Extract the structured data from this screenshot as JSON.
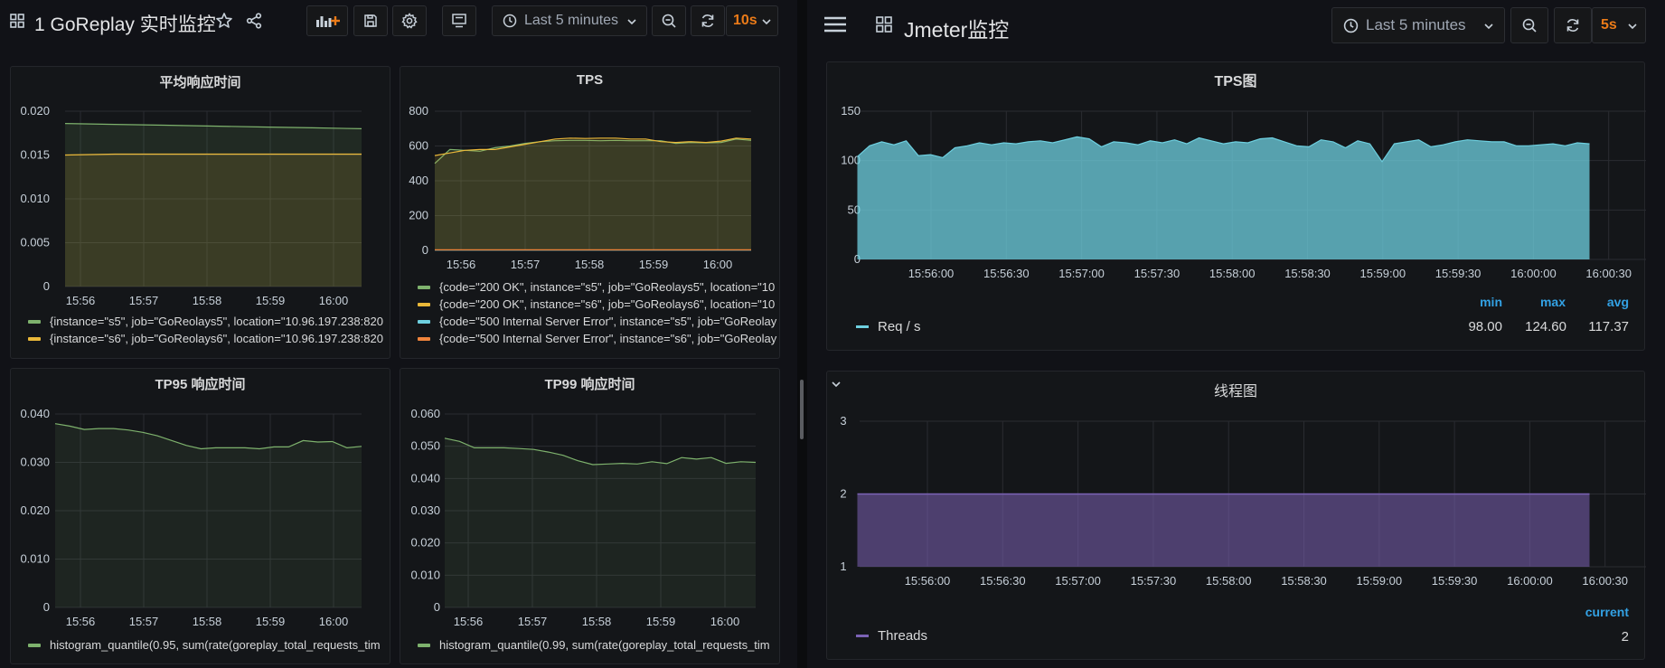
{
  "left": {
    "dashboard_title": "1 GoReplay 实时监控",
    "time_range": "Last 5 minutes",
    "refresh": "10s",
    "panels": [
      {
        "title": "平均响应时间",
        "chart_data": {
          "type": "line",
          "x": [
            "15:56",
            "15:57",
            "15:58",
            "15:59",
            "16:00"
          ],
          "ylim": [
            0,
            0.02
          ],
          "yticks": [
            "0",
            "0.005",
            "0.010",
            "0.015",
            "0.020"
          ],
          "series": [
            {
              "name": "{instance=\"s5\", job=\"GoReolays5\", location=\"10.96.197.238:820",
              "color": "#7eb26d",
              "values": [
                0.0186,
                0.0185,
                0.0184,
                0.0183,
                0.0182,
                0.0181,
                0.018
              ]
            },
            {
              "name": "{instance=\"s6\", job=\"GoReolays6\", location=\"10.96.197.238:820",
              "color": "#eab839",
              "values": [
                0.015,
                0.0151,
                0.0151,
                0.0151,
                0.0151,
                0.0151,
                0.0151
              ]
            }
          ]
        }
      },
      {
        "title": "TPS",
        "chart_data": {
          "type": "line",
          "x": [
            "15:56",
            "15:57",
            "15:58",
            "15:59",
            "16:00"
          ],
          "ylim": [
            0,
            800
          ],
          "yticks": [
            "0",
            "200",
            "400",
            "600",
            "800"
          ],
          "series": [
            {
              "name": "{code=\"200 OK\", instance=\"s5\", job=\"GoReolays5\", location=\"10",
              "color": "#7eb26d",
              "values": [
                500,
                580,
                575,
                570,
                590,
                600,
                615,
                625,
                630,
                632,
                632,
                630,
                632,
                630,
                630,
                630,
                615,
                620,
                618,
                620,
                640,
                632
              ]
            },
            {
              "name": "{code=\"200 OK\", instance=\"s6\", job=\"GoReolays6\", location=\"10",
              "color": "#eab839",
              "values": [
                545,
                560,
                575,
                580,
                580,
                595,
                610,
                625,
                640,
                645,
                643,
                645,
                645,
                640,
                640,
                625,
                620,
                625,
                620,
                628,
                645,
                640
              ]
            },
            {
              "name": "{code=\"500 Internal Server Error\", instance=\"s5\", job=\"GoReolay",
              "color": "#6ed0e0",
              "values": [
                2,
                2,
                2,
                2,
                2,
                2,
                2,
                2,
                2,
                2,
                2,
                2,
                2,
                2,
                2,
                2,
                2,
                2,
                2,
                2,
                2,
                2
              ]
            },
            {
              "name": "{code=\"500 Internal Server Error\", instance=\"s6\", job=\"GoReolay",
              "color": "#ef843c",
              "values": [
                3,
                3,
                3,
                3,
                3,
                3,
                3,
                3,
                3,
                3,
                3,
                3,
                3,
                3,
                3,
                3,
                3,
                3,
                3,
                3,
                3,
                3
              ]
            }
          ]
        }
      },
      {
        "title": "TP95 响应时间",
        "chart_data": {
          "type": "line",
          "x": [
            "15:56",
            "15:57",
            "15:58",
            "15:59",
            "16:00"
          ],
          "ylim": [
            0,
            0.04
          ],
          "yticks": [
            "0",
            "0.010",
            "0.020",
            "0.030",
            "0.040"
          ],
          "series": [
            {
              "name": "histogram_quantile(0.95, sum(rate(goreplay_total_requests_tim",
              "color": "#7eb26d",
              "values": [
                0.038,
                0.0375,
                0.0368,
                0.037,
                0.037,
                0.0367,
                0.0362,
                0.0355,
                0.0345,
                0.0335,
                0.0328,
                0.033,
                0.033,
                0.033,
                0.0328,
                0.0332,
                0.0332,
                0.0345,
                0.0342,
                0.0343,
                0.033,
                0.0333
              ]
            }
          ]
        }
      },
      {
        "title": "TP99 响应时间",
        "chart_data": {
          "type": "line",
          "x": [
            "15:56",
            "15:57",
            "15:58",
            "15:59",
            "16:00"
          ],
          "ylim": [
            0,
            0.06
          ],
          "yticks": [
            "0",
            "0.010",
            "0.020",
            "0.030",
            "0.040",
            "0.050",
            "0.060"
          ],
          "series": [
            {
              "name": "histogram_quantile(0.99, sum(rate(goreplay_total_requests_tim",
              "color": "#7eb26d",
              "values": [
                0.0525,
                0.0515,
                0.0495,
                0.0495,
                0.0495,
                0.0493,
                0.049,
                0.0482,
                0.0472,
                0.0455,
                0.0443,
                0.0445,
                0.0447,
                0.0445,
                0.0452,
                0.0446,
                0.0465,
                0.046,
                0.0465,
                0.0447,
                0.0452,
                0.045
              ]
            }
          ]
        }
      }
    ]
  },
  "right": {
    "dashboard_title": "Jmeter监控",
    "time_range": "Last 5 minutes",
    "refresh": "5s",
    "tps_panel": {
      "title": "TPS图",
      "chart_data": {
        "type": "area",
        "x": [
          "15:56:00",
          "15:56:30",
          "15:57:00",
          "15:57:30",
          "15:58:00",
          "15:58:30",
          "15:59:00",
          "15:59:30",
          "16:00:00",
          "16:00:30"
        ],
        "ylim": [
          0,
          150
        ],
        "yticks": [
          "0",
          "50",
          "100",
          "150"
        ],
        "series": [
          {
            "name": "Req / s",
            "color": "#6ed0e0",
            "values": [
              104,
              115,
              119,
              116,
              120,
              105,
              106,
              103,
              113,
              115,
              118,
              116,
              118,
              117,
              119,
              120,
              118,
              121,
              124,
              122,
              114,
              119,
              118,
              116,
              120,
              118,
              121,
              117,
              123,
              120,
              117,
              119,
              118,
              122,
              123,
              119,
              115,
              114,
              121,
              119,
              113,
              120,
              117,
              99,
              117,
              119,
              121,
              114,
              116,
              119,
              121,
              120,
              119,
              119,
              115,
              115,
              116,
              117,
              115,
              118,
              117
            ]
          }
        ]
      },
      "stats": {
        "headers": [
          "min",
          "max",
          "avg"
        ],
        "values": [
          "98.00",
          "124.60",
          "117.37"
        ]
      }
    },
    "threads_panel": {
      "title": "线程图",
      "chart_data": {
        "type": "area",
        "x": [
          "15:56:00",
          "15:56:30",
          "15:57:00",
          "15:57:30",
          "15:58:00",
          "15:58:30",
          "15:59:00",
          "15:59:30",
          "16:00:00",
          "16:00:30"
        ],
        "ylim": [
          1,
          3
        ],
        "yticks": [
          "1",
          "2",
          "3"
        ],
        "series": [
          {
            "name": "Threads",
            "color": "#7b62b5",
            "values": [
              2,
              2,
              2,
              2,
              2,
              2,
              2,
              2,
              2,
              2,
              2
            ]
          }
        ]
      },
      "stats": {
        "headers": [
          "current"
        ],
        "values": [
          "2"
        ]
      }
    }
  },
  "colors": {
    "accent": "#eb7b18",
    "link_blue": "#33a2e5"
  }
}
